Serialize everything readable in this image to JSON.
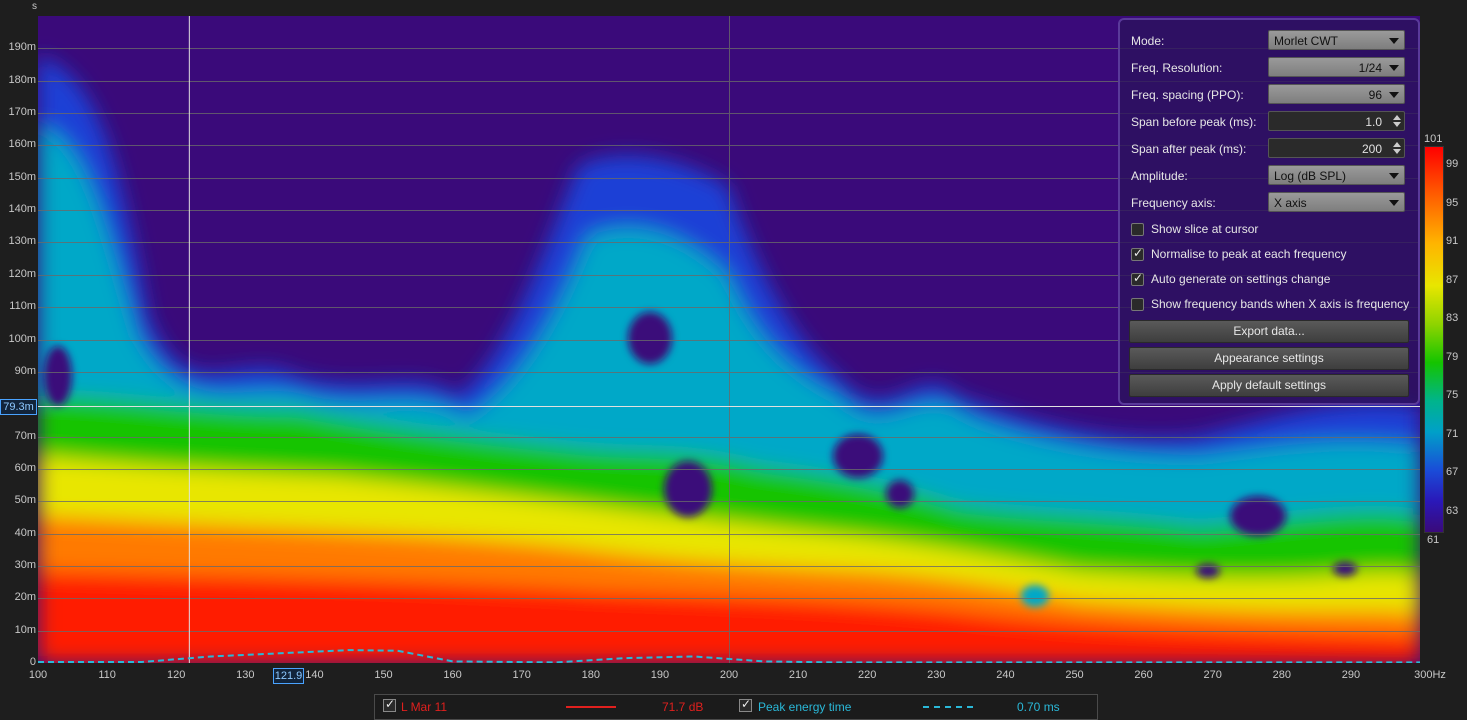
{
  "y_axis": {
    "unit": "s",
    "labels": [
      "190m",
      "180m",
      "170m",
      "160m",
      "150m",
      "140m",
      "130m",
      "120m",
      "110m",
      "100m",
      "90m",
      "70m",
      "60m",
      "50m",
      "40m",
      "30m",
      "20m",
      "10m",
      "0"
    ],
    "label_values_ms": [
      190,
      180,
      170,
      160,
      150,
      140,
      130,
      120,
      110,
      100,
      90,
      70,
      60,
      50,
      40,
      30,
      20,
      10,
      0
    ]
  },
  "x_axis": {
    "unit": "Hz",
    "labels": [
      "100",
      "110",
      "120",
      "130",
      "140",
      "150",
      "160",
      "170",
      "180",
      "190",
      "200",
      "210",
      "220",
      "230",
      "240",
      "250",
      "260",
      "270",
      "280",
      "290",
      "300Hz"
    ],
    "label_values_hz": [
      100,
      110,
      120,
      130,
      140,
      150,
      160,
      170,
      180,
      190,
      200,
      210,
      220,
      230,
      240,
      250,
      260,
      270,
      280,
      290,
      300
    ]
  },
  "cursor": {
    "y_label": "79.3m",
    "x_label": "121.9",
    "x_hz": 121.9,
    "y_ms": 79.3
  },
  "colorbar": {
    "labels": [
      "101",
      "99",
      "95",
      "91",
      "87",
      "83",
      "79",
      "75",
      "71",
      "67",
      "63",
      "61"
    ],
    "label_values_db": [
      101,
      99,
      95,
      91,
      87,
      83,
      79,
      75,
      71,
      67,
      63,
      61
    ]
  },
  "panel": {
    "mode_label": "Mode:",
    "mode_value": "Morlet CWT",
    "freq_res_label": "Freq. Resolution:",
    "freq_res_value": "1/24",
    "freq_spacing_label": "Freq. spacing (PPO):",
    "freq_spacing_value": "96",
    "span_before_label": "Span before peak (ms):",
    "span_before_value": "1.0",
    "span_after_label": "Span after peak (ms):",
    "span_after_value": "200",
    "amplitude_label": "Amplitude:",
    "amplitude_value": "Log (dB SPL)",
    "freq_axis_label": "Frequency axis:",
    "freq_axis_value": "X axis",
    "show_slice": {
      "label": "Show slice at cursor",
      "checked": false
    },
    "normalise": {
      "label": "Normalise to peak at each frequency",
      "checked": true
    },
    "auto_generate": {
      "label": "Auto generate on settings change",
      "checked": true
    },
    "show_bands": {
      "label": "Show frequency bands when X axis is frequency",
      "checked": false
    },
    "export_button": "Export data...",
    "appearance_button": "Appearance settings",
    "defaults_button": "Apply default settings"
  },
  "legend": {
    "series_name": "L Mar 11",
    "series_value": "71.7 dB",
    "series_color": "#e0201e",
    "peak_name": "Peak energy time",
    "peak_value": "0.70 ms",
    "peak_color": "#2ab8d8"
  }
}
